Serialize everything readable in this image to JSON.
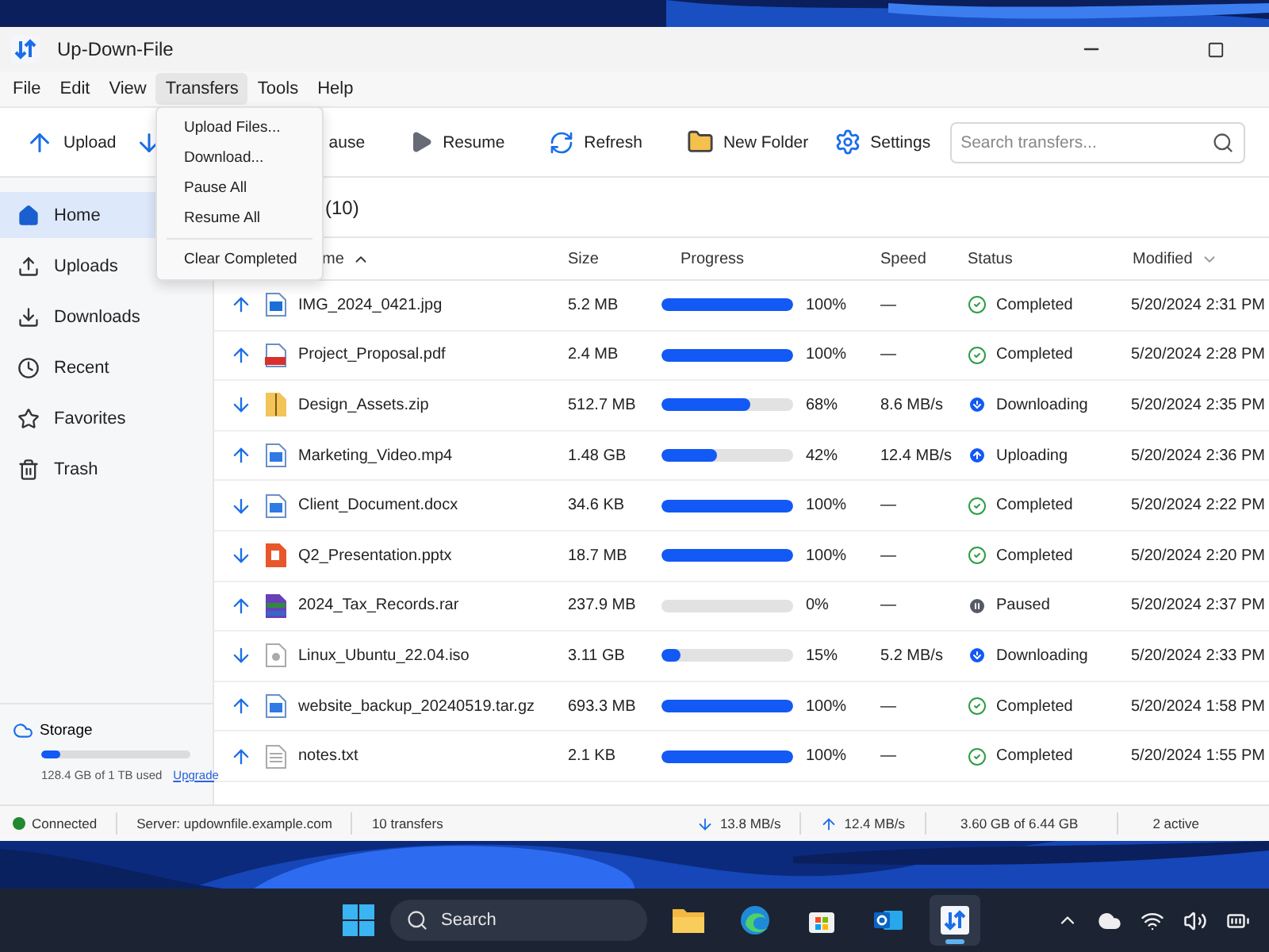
{
  "window": {
    "title": "Up-Down-File"
  },
  "menu_bar": [
    {
      "label": "File",
      "selected": false
    },
    {
      "label": "Edit",
      "selected": false
    },
    {
      "label": "View",
      "selected": false
    },
    {
      "label": "Transfers",
      "selected": true
    },
    {
      "label": "Tools",
      "selected": false
    },
    {
      "label": "Help",
      "selected": false
    }
  ],
  "open_menu": {
    "items": [
      {
        "kind": "option",
        "label": "Upload Files..."
      },
      {
        "kind": "option",
        "label": "Download..."
      },
      {
        "kind": "option",
        "label": "Pause All"
      },
      {
        "kind": "option",
        "label": "Resume All"
      },
      {
        "kind": "separator"
      },
      {
        "kind": "option",
        "label": "Clear Completed"
      }
    ]
  },
  "toolbar": [
    {
      "kind": "upload",
      "label": "Upload"
    },
    {
      "kind": "download"
    },
    {
      "kind": "pause",
      "label": "ause"
    },
    {
      "kind": "resume",
      "label": "Resume"
    },
    {
      "kind": "refresh",
      "label": "Refresh"
    },
    {
      "kind": "new_folder",
      "label": "New Folder"
    },
    {
      "kind": "settings",
      "label": "Settings"
    }
  ],
  "search": {
    "placeholder": "Search transfers..."
  },
  "sidebar": {
    "items": [
      {
        "kind": "home",
        "label": "Home",
        "selected": true
      },
      {
        "kind": "uploads",
        "label": "Uploads",
        "selected": false
      },
      {
        "kind": "downloads",
        "label": "Downloads",
        "selected": false
      },
      {
        "kind": "recent",
        "label": "Recent",
        "selected": false
      },
      {
        "kind": "favorites",
        "label": "Favorites",
        "selected": false
      },
      {
        "kind": "trash",
        "label": "Trash",
        "selected": false
      }
    ],
    "storage": {
      "label": "Storage",
      "level": 0.13,
      "usage": "128.4 GB of 1 TB used",
      "link": "Upgrade"
    }
  },
  "content": {
    "count": "(10)"
  },
  "table": {
    "columns": [
      "me",
      "Size",
      "Progress",
      "Speed",
      "Status",
      "Modified"
    ],
    "rows": [
      {
        "direction": {
          "kind": "up"
        },
        "file": {
          "name": "IMG_2024_0421.jpg"
        },
        "size": "5.2 MB",
        "level": 1,
        "percent": "100%",
        "speed": "—",
        "status": {
          "kind": "completed",
          "label": "Completed"
        },
        "modified": "5/20/2024 2:31 PM"
      },
      {
        "direction": {
          "kind": "up"
        },
        "file": {
          "kind": "pdf",
          "name": "Project_Proposal.pdf"
        },
        "size": "2.4 MB",
        "level": 1,
        "percent": "100%",
        "speed": "—",
        "status": {
          "kind": "completed",
          "label": "Completed"
        },
        "modified": "5/20/2024 2:28 PM"
      },
      {
        "direction": {
          "kind": "down"
        },
        "file": {
          "kind": "zip",
          "name": "Design_Assets.zip"
        },
        "size": "512.7 MB",
        "level": 0.68,
        "percent": "68%",
        "speed": "8.6 MB/s",
        "status": {
          "kind": "downloading",
          "label": "Downloading"
        },
        "modified": "5/20/2024 2:35 PM"
      },
      {
        "direction": {
          "kind": "up"
        },
        "file": {
          "kind": "video",
          "name": "Marketing_Video.mp4"
        },
        "size": "1.48 GB",
        "level": 0.42,
        "percent": "42%",
        "speed": "12.4 MB/s",
        "status": {
          "kind": "uploading",
          "label": "Uploading"
        },
        "modified": "5/20/2024 2:36 PM"
      },
      {
        "direction": {
          "kind": "down"
        },
        "file": {
          "kind": "doc",
          "name": "Client_Document.docx"
        },
        "size": "34.6 KB",
        "level": 1,
        "percent": "100%",
        "speed": "—",
        "status": {
          "kind": "completed",
          "label": "Completed"
        },
        "modified": "5/20/2024 2:22 PM"
      },
      {
        "direction": {
          "kind": "down"
        },
        "file": {
          "kind": "ppt",
          "name": "Q2_Presentation.pptx"
        },
        "size": "18.7 MB",
        "level": 1,
        "percent": "100%",
        "speed": "—",
        "status": {
          "kind": "completed",
          "label": "Completed"
        },
        "modified": "5/20/2024 2:20 PM"
      },
      {
        "direction": {
          "kind": "up"
        },
        "file": {
          "kind": "rar",
          "name": "2024_Tax_Records.rar"
        },
        "size": "237.9 MB",
        "level": 0,
        "percent": "0%",
        "speed": "—",
        "status": {
          "kind": "paused",
          "label": "Paused"
        },
        "modified": "5/20/2024 2:37 PM"
      },
      {
        "direction": {
          "kind": "down"
        },
        "file": {
          "kind": "iso",
          "name": "Linux_Ubuntu_22.04.iso"
        },
        "size": "3.11 GB",
        "level": 0.15,
        "percent": "15%",
        "speed": "5.2 MB/s",
        "status": {
          "kind": "downloading",
          "label": "Downloading"
        },
        "modified": "5/20/2024 2:33 PM"
      },
      {
        "direction": {
          "kind": "up"
        },
        "file": {
          "kind": "code",
          "name": "website_backup_20240519.tar.gz"
        },
        "size": "693.3 MB",
        "level": 1,
        "percent": "100%",
        "speed": "—",
        "status": {
          "kind": "completed",
          "label": "Completed"
        },
        "modified": "5/20/2024 1:58 PM"
      },
      {
        "direction": {
          "kind": "up"
        },
        "file": {
          "kind": "text",
          "name": "notes.txt"
        },
        "size": "2.1 KB",
        "level": 1,
        "percent": "100%",
        "speed": "—",
        "status": {
          "kind": "completed",
          "label": "Completed"
        },
        "modified": "5/20/2024 1:55 PM"
      }
    ]
  },
  "status_bar": {
    "connection": "Connected",
    "connected": true,
    "server": "Server: updownfile.example.com",
    "transfers": "10 transfers",
    "down_speed": "13.8 MB/s",
    "up_speed": "12.4 MB/s",
    "total": "3.60 GB of 6.44 GB",
    "active": "2 active"
  },
  "taskbar": {
    "search": "Search",
    "apps": [
      {
        "kind": "explorer",
        "selected": false
      },
      {
        "kind": "edge",
        "selected": false
      },
      {
        "kind": "store",
        "selected": false
      },
      {
        "kind": "outlook",
        "selected": false
      },
      {
        "kind": "updown",
        "selected": true
      }
    ]
  }
}
